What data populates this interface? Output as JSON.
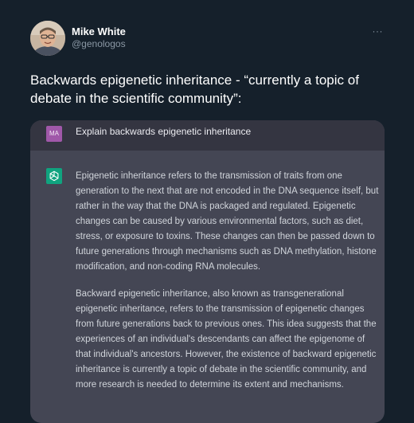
{
  "tweet": {
    "author_name": "Mike White",
    "author_handle": "@genologos",
    "more_label": "···",
    "text": "Backwards epigenetic inheritance - “currently a topic of debate in the scientific community”:"
  },
  "chat": {
    "user_initials": "MA",
    "user_message": "Explain backwards epigenetic inheritance",
    "assistant_paragraphs": [
      "Epigenetic inheritance refers to the transmission of traits from one generation to the next that are not encoded in the DNA sequence itself, but rather in the way that the DNA is packaged and regulated. Epigenetic changes can be caused by various environmental factors, such as diet, stress, or exposure to toxins. These changes can then be passed down to future generations through mechanisms such as DNA methylation, histone modification, and non-coding RNA molecules.",
      "Backward epigenetic inheritance, also known as transgenerational epigenetic inheritance, refers to the transmission of epigenetic changes from future generations back to previous ones. This idea suggests that the experiences of an individual's descendants can affect the epigenome of that individual's ancestors. However, the existence of backward epigenetic inheritance is currently a topic of debate in the scientific community, and more research is needed to determine its extent and mechanisms."
    ]
  },
  "colors": {
    "page_background": "#15202b",
    "user_row_background": "#343541",
    "assistant_background": "#444654",
    "user_avatar": "#a058a9",
    "assistant_avatar": "#10a37f",
    "muted_text": "#8b98a5"
  },
  "icons": {
    "assistant_avatar": "openai-logo-icon",
    "more": "more-horizontal-icon"
  }
}
